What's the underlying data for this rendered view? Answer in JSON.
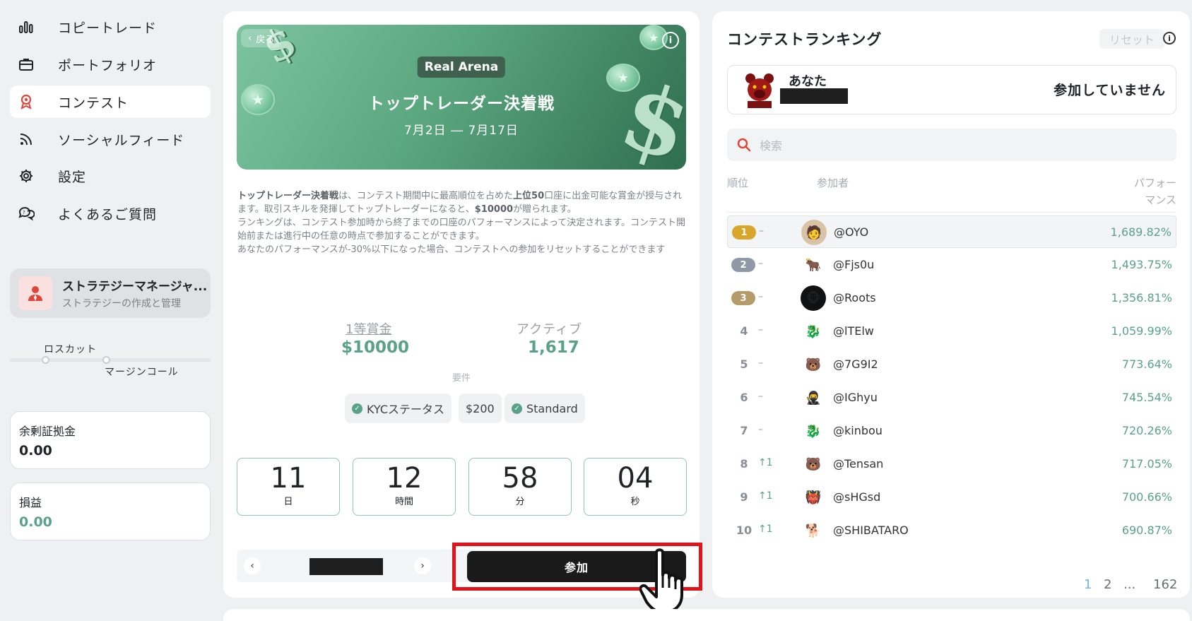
{
  "sidebar": {
    "items": [
      {
        "label": "コピートレード",
        "icon": "chart-icon"
      },
      {
        "label": "ポートフォリオ",
        "icon": "briefcase-icon"
      },
      {
        "label": "コンテスト",
        "icon": "award-icon"
      },
      {
        "label": "ソーシャルフィード",
        "icon": "feed-icon"
      },
      {
        "label": "設定",
        "icon": "gear-icon"
      },
      {
        "label": "よくあるご質問",
        "icon": "faq-icon"
      }
    ],
    "strategy": {
      "title": "ストラテジーマネージャ...",
      "subtitle": "ストラテジーの作成と管理"
    },
    "losscut_label": "ロスカット",
    "margincall_label": "マージンコール",
    "free_margin": {
      "label": "余剰証拠金",
      "value": "0.00"
    },
    "pnl": {
      "label": "損益",
      "value": "0.00"
    }
  },
  "contest": {
    "back_label": "戻る",
    "arena_badge": "Real Arena",
    "title": "トップトレーダー決着戦",
    "dates": "7月2日 ― 7月17日",
    "desc": {
      "p1_bold": "トップトレーダー決着戦",
      "p1_a": "は、コンテスト期間中に最高順位を占めた",
      "p1_bold2": "上位50",
      "p1_b": "口座に出金可能な賞金が授与されます。取引スキルを発揮してトップトレーダーになると、",
      "p1_bold3": "$10000",
      "p1_c": "が贈られます。",
      "p2": "ランキングは、コンテスト参加時から終了までの口座のパフォーマンスによって決定されます。コンテスト開始前または進行中の任意の時点で参加することができます。",
      "p3": "あなたのパフォーマンスが-30%以下になった場合、コンテストへの参加をリセットすることができます"
    },
    "prize_label": "1等賞金",
    "prize_value": "$10000",
    "active_label": "アクティブ",
    "active_value": "1,617",
    "requirements_label": "要件",
    "requirements": [
      "KYCステータス",
      "$200",
      "Standard"
    ],
    "countdown": [
      {
        "value": "11",
        "unit": "日"
      },
      {
        "value": "12",
        "unit": "時間"
      },
      {
        "value": "58",
        "unit": "分"
      },
      {
        "value": "04",
        "unit": "秒"
      }
    ],
    "join_label": "参加"
  },
  "ranking": {
    "title": "コンテストランキング",
    "reset_label": "リセット",
    "you_label": "あなた",
    "you_status": "参加していません",
    "search_placeholder": "検索",
    "col_rank": "順位",
    "col_participant": "参加者",
    "col_perf_1": "パフォー",
    "col_perf_2": "マンス",
    "rows": [
      {
        "rank": "1",
        "change": "–",
        "name": "@OYO",
        "perf": "1,689.82%"
      },
      {
        "rank": "2",
        "change": "–",
        "name": "@Fjs0u",
        "perf": "1,493.75%"
      },
      {
        "rank": "3",
        "change": "–",
        "name": "@Roots",
        "perf": "1,356.81%"
      },
      {
        "rank": "4",
        "change": "–",
        "name": "@lTElw",
        "perf": "1,059.99%"
      },
      {
        "rank": "5",
        "change": "–",
        "name": "@7G9I2",
        "perf": "773.64%"
      },
      {
        "rank": "6",
        "change": "–",
        "name": "@IGhyu",
        "perf": "745.54%"
      },
      {
        "rank": "7",
        "change": "–",
        "name": "@kinbou",
        "perf": "720.26%"
      },
      {
        "rank": "8",
        "change": "↑1",
        "name": "@Tensan",
        "perf": "717.05%"
      },
      {
        "rank": "9",
        "change": "↑1",
        "name": "@sHGsd",
        "perf": "700.66%"
      },
      {
        "rank": "10",
        "change": "↑1",
        "name": "@SHIBATARO",
        "perf": "690.87%"
      }
    ],
    "pages": [
      "1",
      "2",
      "...",
      "162"
    ]
  },
  "colors": {
    "accent_green": "#5aa287",
    "gold": "#d8a62a",
    "silver": "#8f98a6",
    "bronze": "#b59a6a",
    "highlight_red": "#e0141a"
  }
}
